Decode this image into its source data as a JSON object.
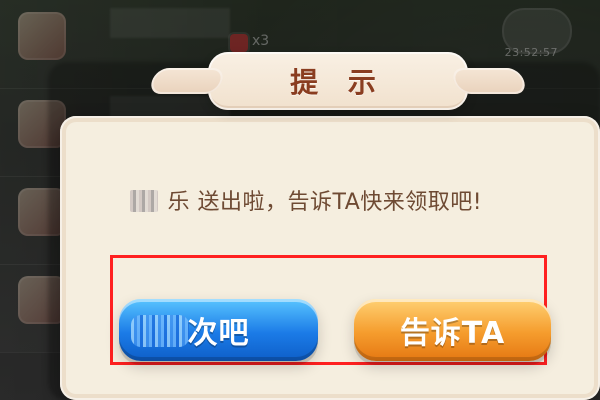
{
  "background": {
    "badge_text": "x3",
    "timer_text": "23:52:57"
  },
  "dialog": {
    "title": "提 示",
    "message": "乐 送出啦，告诉TA快来领取吧!"
  },
  "buttons": {
    "left_label": "次吧",
    "right_label": "告诉TA"
  },
  "colors": {
    "highlight_border": "#ff2020",
    "title_text": "#8a3d20",
    "message_text": "#6e4a33",
    "blue_button": "#1b7be7",
    "orange_button": "#f59c2d"
  }
}
